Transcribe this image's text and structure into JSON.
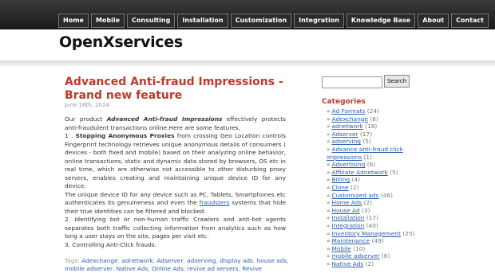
{
  "nav": {
    "items": [
      "Home",
      "Mobile",
      "Consulting",
      "Installation",
      "Customization",
      "Integration",
      "Knowledge Base",
      "About",
      "Contact"
    ]
  },
  "site": {
    "title": "OpenXservices"
  },
  "post": {
    "title": "Advanced Anti-fraud Impressions - Brand new feature",
    "date": "June 18th, 2014",
    "p1_a": "Our product ",
    "p1_em": "Advanced Anti-fraud Impressions",
    "p1_b": " effectively protects anti-fraudulent transactions online.Here are some features,",
    "p2_num": "1 . ",
    "p2_strong": "Stopping Anonymous Proxies",
    "p2_text": " from crossing Geo Location controls Fingerprint technology retrieves unique anonymous details of consumers ( devices - both fixed and mobile) based on their analyzing online behavior, online transactions, static and dynamic data stored by browsers, OS etc in real time, which are otherwise not accessible to other disturbing proxy servers, enables creating and maintaining unique device ID for any device.",
    "p3_a": "The unique device ID for any device such as PC, Tablets, Smartphones etc authenticates its genuineness and even the ",
    "p3_link": "fraudsters",
    "p3_b": " systems that hide their true identities can be filtered and blocked.",
    "p4": "2. Identifying bot or non-human traffic Crawlers and anti-bot agents separates both traffic collecting information from analytics such as how long a user stays on the site, pages per visit etc.",
    "p5": "3. Controlling Anti-Click frauds.",
    "tags_label": "Tags:",
    "tags": [
      "Adexchange",
      "adnetwork",
      "Adserver",
      "adserving",
      "display ads",
      "house ads",
      "mobile adserver",
      "Native Ads",
      "Online Ads",
      "revive ad servers",
      "Revive"
    ]
  },
  "sidebar": {
    "search_button": "Search",
    "search_value": "",
    "categories_heading": "Categories",
    "categories": [
      {
        "name": "Ad Formats",
        "count": "(24)"
      },
      {
        "name": "Adexchange",
        "count": "(6)"
      },
      {
        "name": "adnetwork",
        "count": "(18)"
      },
      {
        "name": "Adserver",
        "count": "(17)"
      },
      {
        "name": "adserving",
        "count": "(5)"
      },
      {
        "name": "Advance anti-fraud click impressions",
        "count": "(1)"
      },
      {
        "name": "Advertising",
        "count": "(6)"
      },
      {
        "name": "Affiliate Adnetwork",
        "count": "(5)"
      },
      {
        "name": "Billing",
        "count": "(4)"
      },
      {
        "name": "Clone",
        "count": "(2)"
      },
      {
        "name": "Customized ads",
        "count": "(46)"
      },
      {
        "name": "Home Ads",
        "count": "(2)"
      },
      {
        "name": "House Ad",
        "count": "(3)"
      },
      {
        "name": "Installation",
        "count": "(17)"
      },
      {
        "name": "Integration",
        "count": "(40)"
      },
      {
        "name": "Inventory Management",
        "count": "(25)"
      },
      {
        "name": "Maintenance",
        "count": "(49)"
      },
      {
        "name": "Mobile",
        "count": "(10)"
      },
      {
        "name": "mobile adserver",
        "count": "(6)"
      },
      {
        "name": "Native Ads",
        "count": "(2)"
      }
    ]
  }
}
